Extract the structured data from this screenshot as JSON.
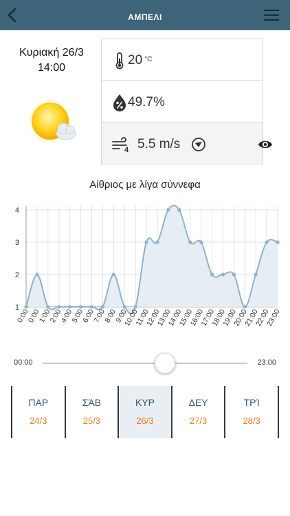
{
  "header": {
    "title": "ΑΜΠΕΛΙ",
    "back_icon": "chevron-left-icon",
    "menu_icon": "hamburger-menu-icon"
  },
  "current": {
    "date": "Κυριακή 26/3",
    "time": "14:00",
    "weather_icon": "partly-cloudy-sun-icon",
    "temperature": {
      "value": "20",
      "unit": "°C",
      "icon": "thermometer-icon"
    },
    "humidity": {
      "value": "49.7%",
      "icon": "humidity-drop-icon"
    },
    "wind": {
      "value": "5.5 m/s",
      "icon": "wind-icon",
      "direction_icon": "wind-direction-icon",
      "eye_icon": "eye-icon"
    }
  },
  "condition": "Αίθριος με λίγα σύννεφα",
  "chart_data": {
    "type": "area",
    "x": [
      "0:00",
      "0:00",
      "1:00",
      "2:00",
      "4:00",
      "5:00",
      "6:00",
      "7:00",
      "8:00",
      "9:00",
      "10:00",
      "11:00",
      "12:00",
      "13:00",
      "14:00",
      "15:00",
      "16:00",
      "17:00",
      "18:00",
      "19:00",
      "20:00",
      "21:00",
      "22:00",
      "23:00"
    ],
    "values": [
      1,
      2,
      1,
      1,
      1,
      1,
      1,
      1,
      2,
      1,
      1,
      3,
      3,
      4,
      4,
      3,
      3,
      2,
      2,
      2,
      1,
      2,
      3,
      3
    ],
    "ylim": [
      1,
      4
    ],
    "yticks": [
      1,
      2,
      3,
      4
    ],
    "title": "",
    "xlabel": "",
    "ylabel": "",
    "grid": true,
    "colors": {
      "line": "#8fb3c8",
      "fill": "#e6eef3",
      "point": "#8fb3c8"
    }
  },
  "slider": {
    "start_label": "00:00",
    "end_label": "23:00",
    "value": 14
  },
  "days": [
    {
      "name": "ΠΑΡ",
      "date": "24/3",
      "active": false
    },
    {
      "name": "ΣΆΒ",
      "date": "25/3",
      "active": false
    },
    {
      "name": "ΚΥΡ",
      "date": "26/3",
      "active": true
    },
    {
      "name": "ΔΕΥ",
      "date": "27/3",
      "active": false
    },
    {
      "name": "ΤΡΊ",
      "date": "28/3",
      "active": false
    }
  ],
  "colors": {
    "header_bg": "#3d6478",
    "accent_orange": "#e67e22",
    "day_name": "#2c5872"
  }
}
